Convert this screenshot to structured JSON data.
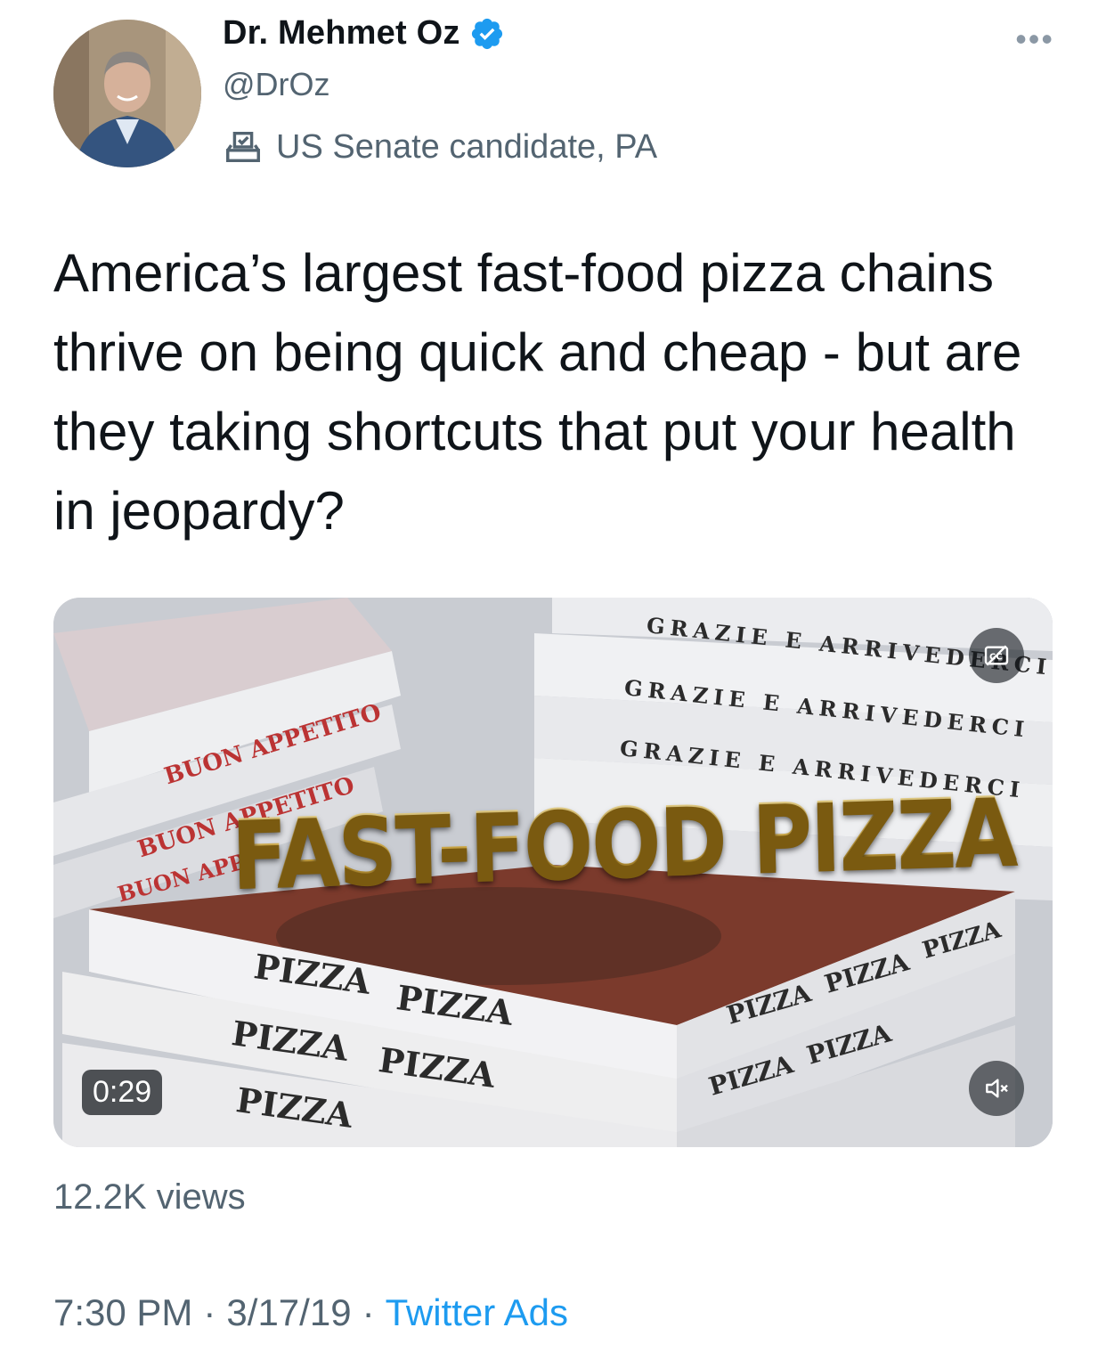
{
  "author": {
    "name": "Dr. Mehmet Oz",
    "handle": "@DrOz",
    "label": "US Senate candidate, PA",
    "verified": true
  },
  "tweet": {
    "text": "America’s largest fast-food pizza chains thrive on being quick and cheap - but are they taking shortcuts that put your health in jeopardy?"
  },
  "video": {
    "headline": "FAST-FOOD PIZZA",
    "duration": "0:29",
    "box_texts": {
      "buon_appetito": "BUON APPETITO",
      "buon_app": "BUON APP",
      "grazie": "GRAZIE E ARRIVEDERCI",
      "pizza": "PIZZA"
    }
  },
  "stats": {
    "views": "12.2K views"
  },
  "meta": {
    "time": "7:30 PM",
    "date": "3/17/19",
    "separator": "·",
    "source": "Twitter Ads"
  },
  "colors": {
    "accent": "#1d9bf0",
    "secondary_text": "#536471",
    "primary_text": "#0f1419"
  },
  "icons": [
    "verified-badge-icon",
    "ballot-box-icon",
    "more-icon",
    "closed-captions-icon",
    "muted-speaker-icon"
  ]
}
